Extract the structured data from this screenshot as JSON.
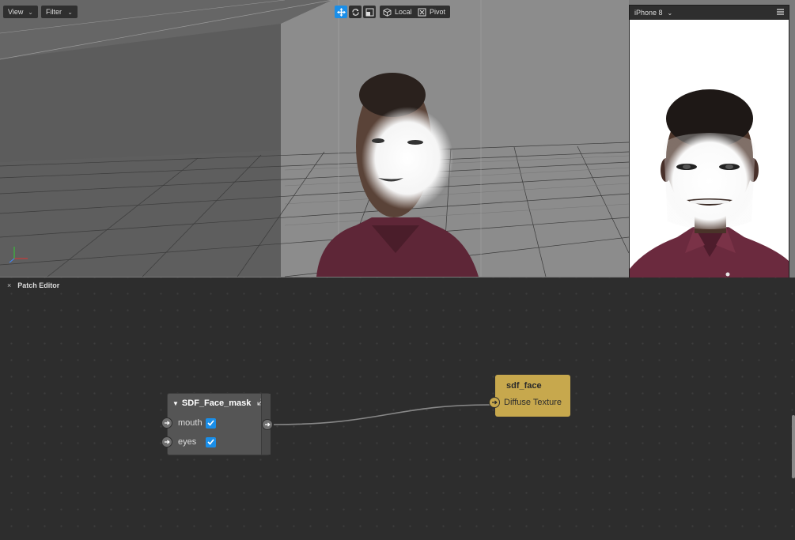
{
  "viewport": {
    "view_label": "View",
    "filter_label": "Filter",
    "local_label": "Local",
    "pivot_label": "Pivot"
  },
  "simulator": {
    "device_label": "iPhone 8"
  },
  "patch_editor": {
    "title": "Patch Editor",
    "close_glyph": "×",
    "mask_node": {
      "title": "SDF_Face_mask",
      "inputs": [
        {
          "label": "mouth",
          "checked": true
        },
        {
          "label": "eyes",
          "checked": true
        }
      ]
    },
    "face_node": {
      "title": "sdf_face",
      "input_label": "Diffuse Texture"
    }
  },
  "colors": {
    "accent_blue": "#1a8ee8",
    "node_gold": "#c7a84d",
    "node_gray": "#555555",
    "shirt": "#6b2a3e"
  }
}
